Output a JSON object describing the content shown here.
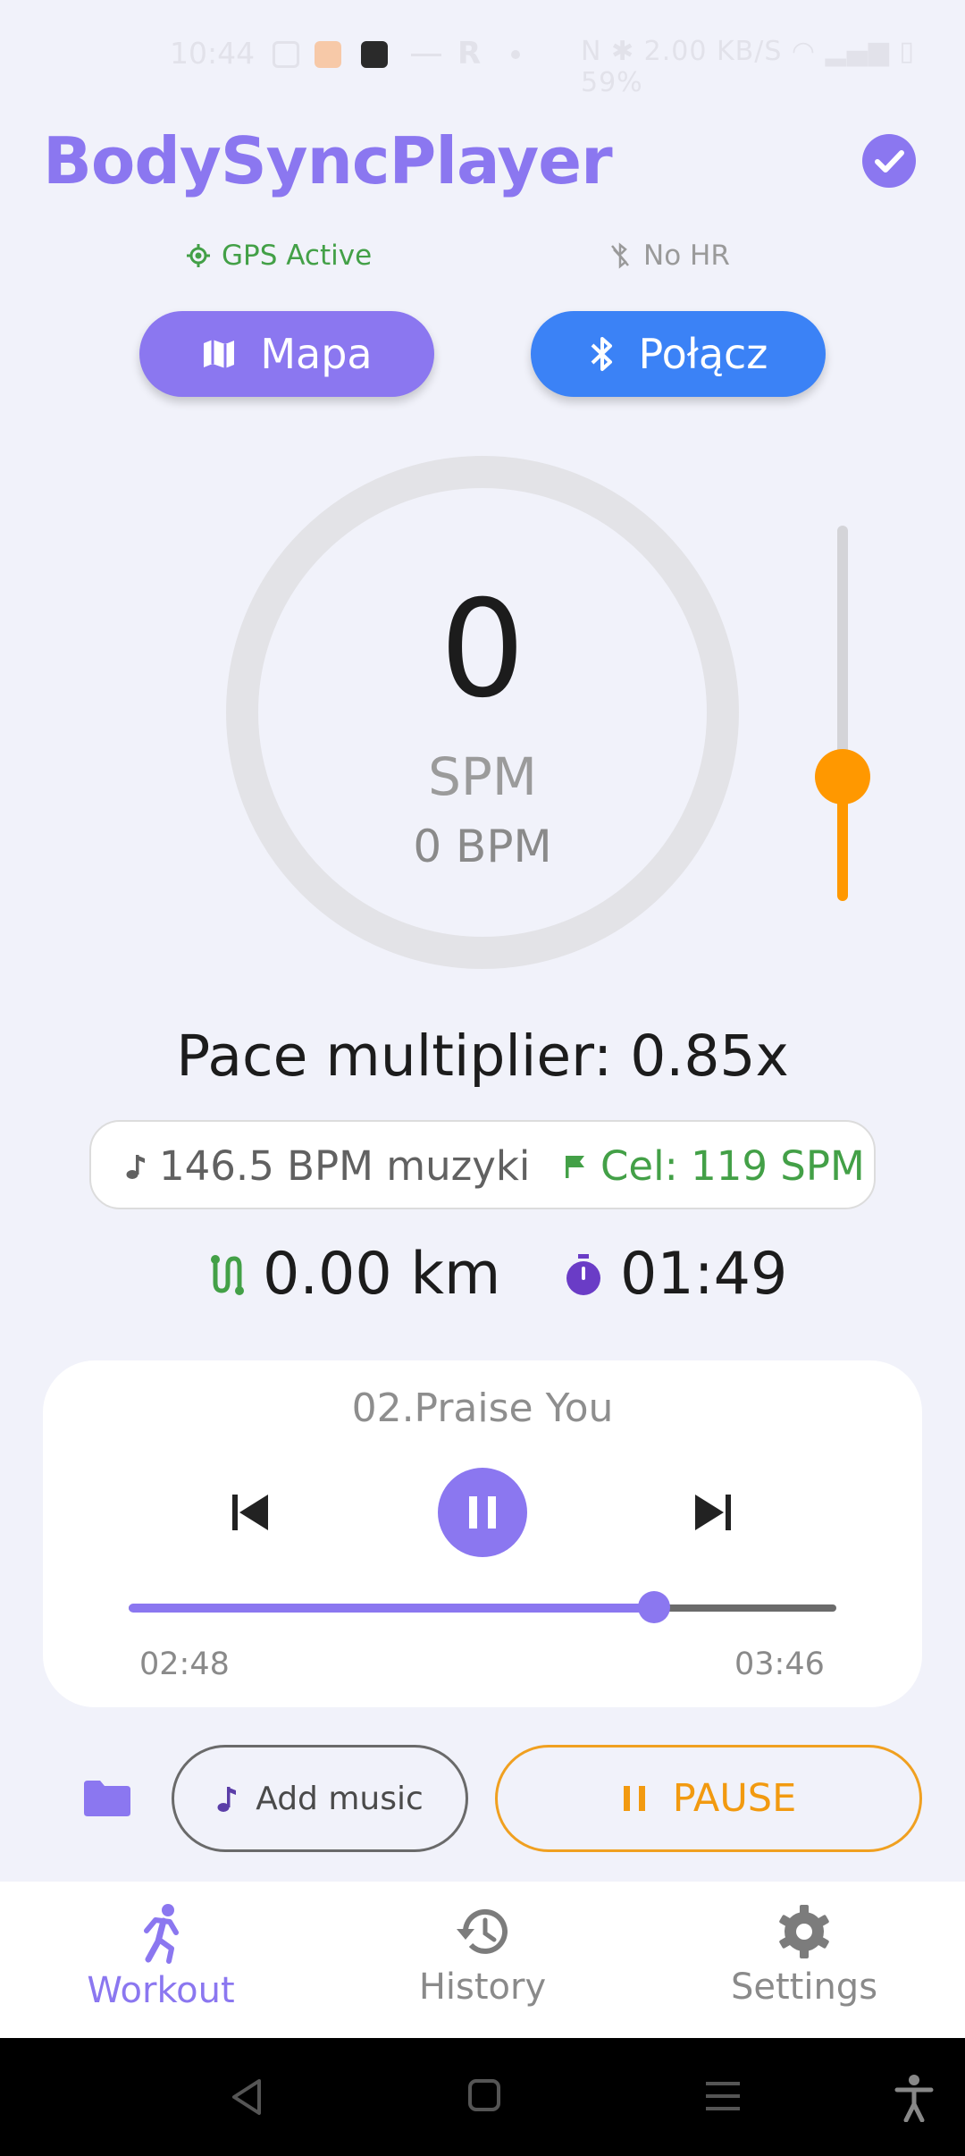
{
  "status_bar": {
    "time": "10:44",
    "right": "N ✱ 2.00 KB/S ◠ ▂▄▆ ▯ 59%"
  },
  "header": {
    "title": "BodySyncPlayer",
    "gps_status": "GPS Active",
    "hr_status": "No HR"
  },
  "buttons": {
    "map_label": "Mapa",
    "connect_label": "Połącz"
  },
  "gauge": {
    "spm_value": "0",
    "spm_label": "SPM",
    "bpm_label": "0 BPM"
  },
  "slider": {
    "level": 0.3
  },
  "pace": {
    "text": "Pace multiplier: 0.85x"
  },
  "info": {
    "music_bpm": "146.5 BPM muzyki",
    "target": "Cel: 119 SPM"
  },
  "stats": {
    "distance": "0.00 km",
    "time": "01:49"
  },
  "player": {
    "track_title": "02.Praise You",
    "elapsed": "02:48",
    "total": "03:46",
    "progress": 0.743
  },
  "controls": {
    "add_music_label": "Add music",
    "pause_label": "PAUSE"
  },
  "nav": {
    "items": [
      {
        "label": "Workout",
        "active": true
      },
      {
        "label": "History",
        "active": false
      },
      {
        "label": "Settings",
        "active": false
      }
    ]
  },
  "colors": {
    "accent": "#8b77f0",
    "connect": "#3b82f6",
    "orange": "#ff9800",
    "green": "#43a047"
  }
}
